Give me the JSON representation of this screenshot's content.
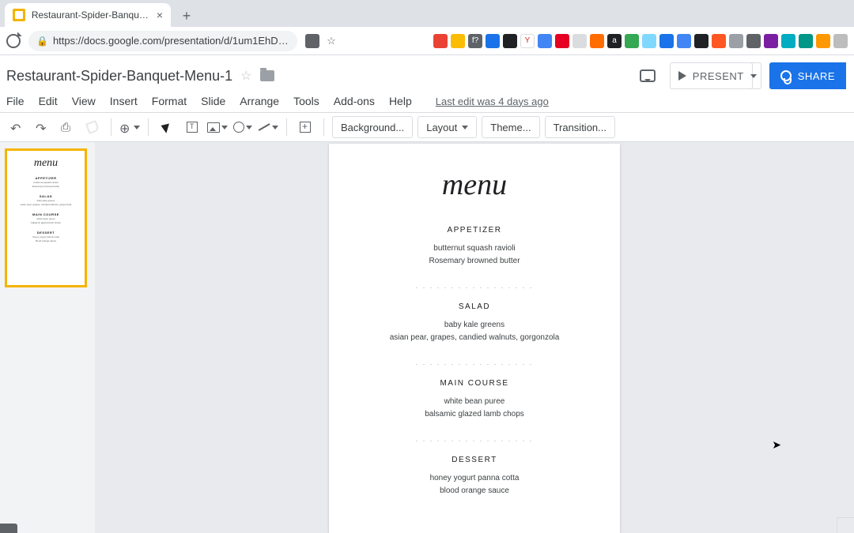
{
  "browser": {
    "tab_title": "Restaurant-Spider-Banquet-M",
    "url": "https://docs.google.com/presentation/d/1um1EhDsK..."
  },
  "doc": {
    "title": "Restaurant-Spider-Banquet-Menu-1",
    "last_edit": "Last edit was 4 days ago"
  },
  "menubar": {
    "file": "File",
    "edit": "Edit",
    "view": "View",
    "insert": "Insert",
    "format": "Format",
    "slide": "Slide",
    "arrange": "Arrange",
    "tools": "Tools",
    "addons": "Add-ons",
    "help": "Help"
  },
  "header_buttons": {
    "present": "PRESENT",
    "share": "SHARE"
  },
  "toolbar": {
    "background": "Background...",
    "layout": "Layout",
    "theme": "Theme...",
    "transition": "Transition..."
  },
  "slide": {
    "title": "menu",
    "sections": [
      {
        "heading": "APPETIZER",
        "lines": [
          "butternut squash ravioli",
          "Rosemary browned butter"
        ]
      },
      {
        "heading": "SALAD",
        "lines": [
          "baby kale greens",
          "asian pear, grapes, candied walnuts, gorgonzola"
        ]
      },
      {
        "heading": "MAIN COURSE",
        "lines": [
          "white bean puree",
          "balsamic glazed lamb chops"
        ]
      },
      {
        "heading": "DESSERT",
        "lines": [
          "honey yogurt panna cotta",
          "blood orange sauce"
        ]
      }
    ],
    "dots": ". . . . . . . . . . . . . . . . ."
  }
}
